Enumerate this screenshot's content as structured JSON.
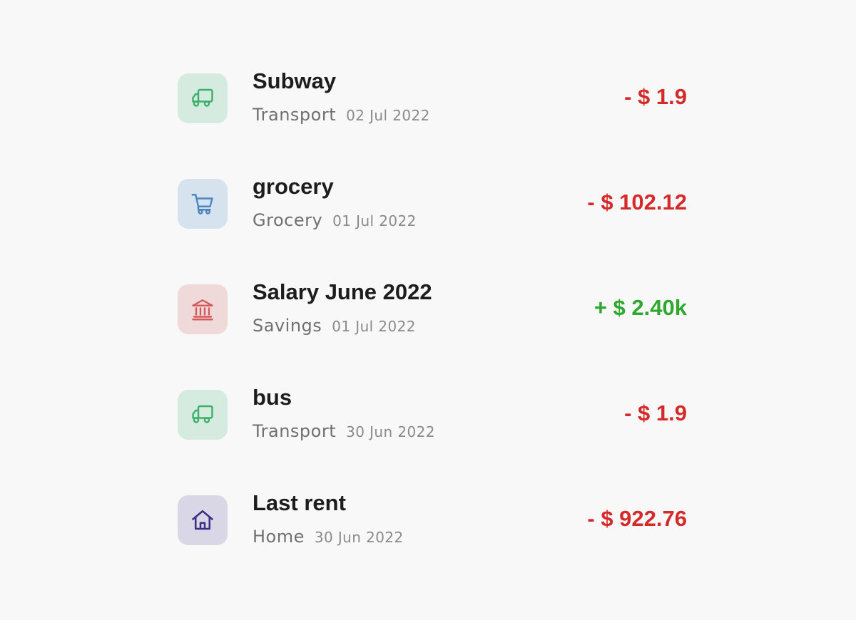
{
  "colors": {
    "expense": "#d42a2a",
    "income": "#2ea82e",
    "transport_icon": "#3daf6b",
    "transport_bg": "#d6ebe0",
    "grocery_icon": "#4a87c0",
    "grocery_bg": "#d6e2ed",
    "savings_icon": "#d35a5a",
    "savings_bg": "#efd9d9",
    "home_icon": "#3a3187",
    "home_bg": "#d9d6e6"
  },
  "transactions": [
    {
      "title": "Subway",
      "category": "Transport",
      "date": "02 Jul 2022",
      "amount": "- $ 1.9",
      "type": "expense",
      "icon": "truck-icon"
    },
    {
      "title": "grocery",
      "category": "Grocery",
      "date": "01 Jul 2022",
      "amount": "- $ 102.12",
      "type": "expense",
      "icon": "cart-icon"
    },
    {
      "title": "Salary June 2022",
      "category": "Savings",
      "date": "01 Jul 2022",
      "amount": "+ $ 2.40k",
      "type": "income",
      "icon": "bank-icon"
    },
    {
      "title": "bus",
      "category": "Transport",
      "date": "30 Jun 2022",
      "amount": "- $ 1.9",
      "type": "expense",
      "icon": "truck-icon"
    },
    {
      "title": "Last rent",
      "category": "Home",
      "date": "30 Jun 2022",
      "amount": "- $ 922.76",
      "type": "expense",
      "icon": "home-icon"
    }
  ]
}
